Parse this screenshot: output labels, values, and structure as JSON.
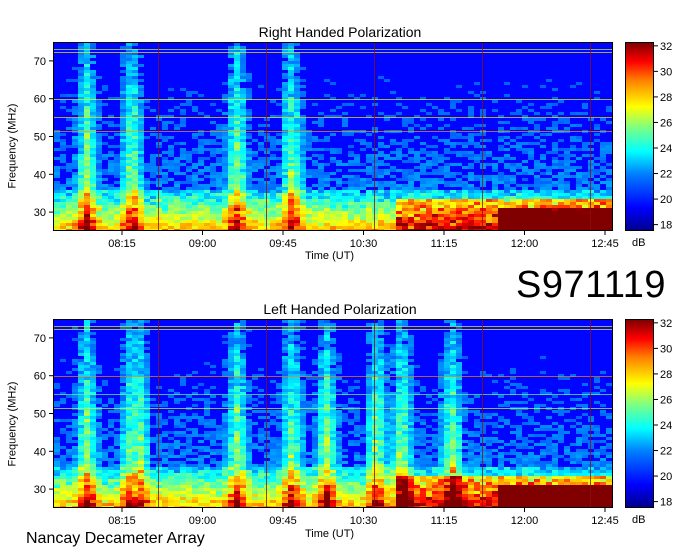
{
  "observation_id": "S971119",
  "instrument": "Nancay Decameter Array",
  "chart_data": [
    {
      "type": "heatmap",
      "title": "Right Handed Polarization",
      "xlabel": "Time (UT)",
      "ylabel": "Frequency (MHz)",
      "x_ticks": [
        "08:15",
        "09:00",
        "09:45",
        "10:30",
        "11:15",
        "12:00",
        "12:45"
      ],
      "y_ticks": [
        30,
        40,
        50,
        60,
        70
      ],
      "ylim": [
        25,
        75
      ],
      "colorbar": {
        "label": "dB",
        "ticks": [
          18,
          20,
          22,
          24,
          26,
          28,
          30,
          32
        ],
        "range": [
          17.5,
          32.3
        ]
      },
      "colormap": "jet"
    },
    {
      "type": "heatmap",
      "title": "Left Handed Polarization",
      "xlabel": "Time (UT)",
      "ylabel": "Frequency (MHz)",
      "x_ticks": [
        "08:15",
        "09:00",
        "09:45",
        "10:30",
        "11:15",
        "12:00",
        "12:45"
      ],
      "y_ticks": [
        30,
        40,
        50,
        60,
        70
      ],
      "ylim": [
        25,
        75
      ],
      "colorbar": {
        "label": "dB",
        "ticks": [
          18,
          20,
          22,
          24,
          26,
          28,
          30,
          32
        ],
        "range": [
          17.5,
          32.3
        ]
      },
      "colormap": "jet"
    }
  ]
}
